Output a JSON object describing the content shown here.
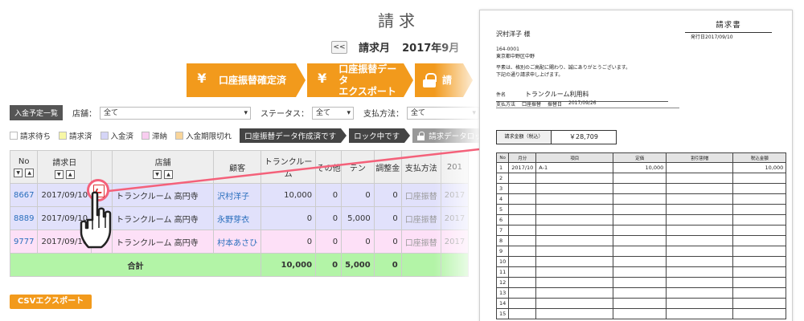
{
  "page": {
    "title": "請求"
  },
  "month_nav": {
    "prev_label": "<<",
    "label": "請求月",
    "value": "2017年9月"
  },
  "steps": [
    {
      "icon": "yen-icon",
      "label": "口座振替確定済"
    },
    {
      "icon": "yen-icon",
      "label_line1": "口座振替データ",
      "label_line2": "エクスポート"
    },
    {
      "icon": "lock-icon",
      "label": "請"
    }
  ],
  "filters": {
    "title": "入金予定一覧",
    "store_label": "店舗：",
    "store_value": "全て",
    "status_label": "ステータス：",
    "status_value": "全て",
    "payment_label": "支払方法：",
    "payment_value": "全て"
  },
  "legend": [
    {
      "label": "請求待ち",
      "color": "#ffffff"
    },
    {
      "label": "請求済",
      "color": "#f7f7a6"
    },
    {
      "label": "入金済",
      "color": "#d5d5f7"
    },
    {
      "label": "滞納",
      "color": "#f9cdf0"
    },
    {
      "label": "入金期限切れ",
      "color": "#f9d59a"
    }
  ],
  "legend_buttons": [
    {
      "label": "口座振替データ作成済です"
    },
    {
      "label": "ロック中です"
    },
    {
      "label": "請求データロッ"
    }
  ],
  "table": {
    "headers": [
      "No",
      "請求日",
      "",
      "店舗",
      "顧客",
      "トランクルーム",
      "その他",
      "テン",
      "調整金",
      "支払方法",
      "201"
    ],
    "rows": [
      {
        "no": "8667",
        "date": "2017/09/10",
        "store": "トランクルーム 高円寺",
        "customer": "沢村洋子",
        "trunk": "10,000",
        "other": "0",
        "ten": "0",
        "adjust": "0",
        "payment": "口座振替",
        "extra": "2017"
      },
      {
        "no": "8889",
        "date": "2017/09/10",
        "store": "トランクルーム 高円寺",
        "customer": "永野芽衣",
        "trunk": "0",
        "other": "0",
        "ten": "5,000",
        "adjust": "0",
        "payment": "口座振替",
        "extra": "2017"
      },
      {
        "no": "9777",
        "date": "2017/09/10",
        "store": "トランクルーム 高円寺",
        "customer": "村本あさひ",
        "trunk": "0",
        "other": "0",
        "ten": "0",
        "adjust": "0",
        "payment": "口座振替",
        "extra": "2017"
      }
    ],
    "total": {
      "label": "合計",
      "trunk": "10,000",
      "other": "0",
      "ten": "5,000",
      "adjust": "0"
    }
  },
  "csv_button": "CSVエクスポート",
  "invoice": {
    "title": "請求書",
    "issue_date": "発行日2017/09/10",
    "customer": "沢村洋子 様",
    "postal": "164-0001",
    "address": "東京都中野区中野",
    "message_line1": "平素は、格別のご高配に賜わり、誠にありがとうございます。",
    "message_line2": "下記の通り請求申し上げます。",
    "subject_label": "件名",
    "subject_value": "トランクルーム利用料",
    "payment_label": "支払方法",
    "payment_value": "口座振替",
    "transfer_date_label": "振替日",
    "transfer_date_value": "2017/09/26",
    "amount_label": "請求金額（税込）",
    "amount_value": "￥28,709",
    "columns": [
      "No",
      "月分",
      "項目",
      "定価",
      "割引割増",
      "税込金額"
    ],
    "rows": [
      {
        "no": "1",
        "month": "2017/10",
        "item": "A-1",
        "price": "10,000",
        "discount": "",
        "total": "10,000"
      },
      {
        "no": "2"
      },
      {
        "no": "3"
      },
      {
        "no": "4"
      },
      {
        "no": "5"
      },
      {
        "no": "6"
      },
      {
        "no": "7"
      },
      {
        "no": "8"
      },
      {
        "no": "9"
      },
      {
        "no": "10"
      },
      {
        "no": "11"
      },
      {
        "no": "12"
      },
      {
        "no": "13"
      },
      {
        "no": "14"
      },
      {
        "no": "15"
      }
    ]
  },
  "colors": {
    "accent": "#f29a1c",
    "callout": "#f4617a",
    "paid": "#e1e1fb",
    "overdue": "#fde0f7",
    "total": "#b3f4a7"
  }
}
